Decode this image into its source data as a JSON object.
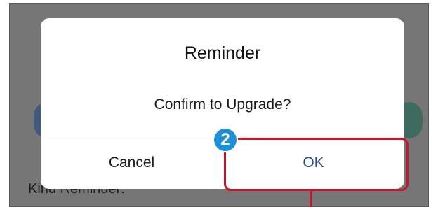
{
  "background": {
    "text": "Kind Reminder:"
  },
  "dialog": {
    "title": "Reminder",
    "message": "Confirm to Upgrade?",
    "cancel_label": "Cancel",
    "ok_label": "OK"
  },
  "annotation": {
    "step_number": "2",
    "highlight_color": "#c4172c",
    "badge_color": "#1e90d6"
  }
}
